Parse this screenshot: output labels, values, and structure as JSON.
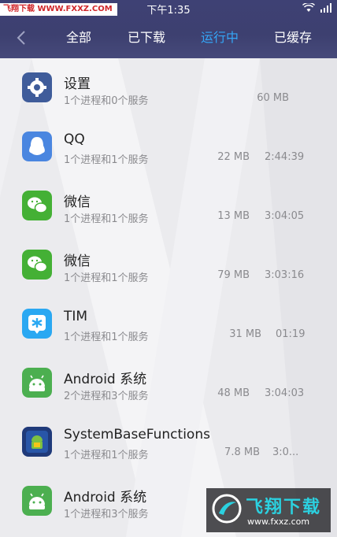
{
  "status_bar": {
    "watermark": "飞翔下载 WWW.FXXZ.COM",
    "time": "下午1:35"
  },
  "nav": {
    "back_icon": "chevron-left-icon",
    "tabs": [
      {
        "label": "全部",
        "active": false
      },
      {
        "label": "已下载",
        "active": false
      },
      {
        "label": "运行中",
        "active": true
      },
      {
        "label": "已缓存",
        "active": false
      }
    ]
  },
  "apps": [
    {
      "name": "设置",
      "sub": "1个进程和0个服务",
      "size": "60 MB",
      "time": "",
      "icon": "settings-gear-icon"
    },
    {
      "name": "QQ",
      "sub": "1个进程和1个服务",
      "size": "22 MB",
      "time": "2:44:39",
      "icon": "qq-penguin-icon"
    },
    {
      "name": "微信",
      "sub": "1个进程和1个服务",
      "size": "13 MB",
      "time": "3:04:05",
      "icon": "wechat-icon"
    },
    {
      "name": "微信",
      "sub": "1个进程和1个服务",
      "size": "79 MB",
      "time": "3:03:16",
      "icon": "wechat-icon"
    },
    {
      "name": "TIM",
      "sub": "1个进程和1个服务",
      "size": "31 MB",
      "time": "01:19",
      "icon": "tim-icon"
    },
    {
      "name": "Android 系统",
      "sub": "2个进程和3个服务",
      "size": "48 MB",
      "time": "3:04:03",
      "icon": "android-icon"
    },
    {
      "name": "SystemBaseFunctions",
      "sub": "1个进程和1个服务",
      "size": "7.8 MB",
      "time": "3:0...",
      "icon": "system-base-functions-icon"
    },
    {
      "name": "Android 系统",
      "sub": "1个进程和3个服务",
      "size": "",
      "time": "",
      "icon": "android-icon"
    }
  ],
  "logo_watermark": {
    "text": "飞翔下载",
    "url": "www.fxxz.com"
  },
  "colors": {
    "header": "#3e4174",
    "active_tab": "#34a6f7",
    "wechat_green": "#44b035",
    "qq_blue": "#4a86e0",
    "tim_blue": "#2aa8f2",
    "android_green": "#4caf50"
  }
}
